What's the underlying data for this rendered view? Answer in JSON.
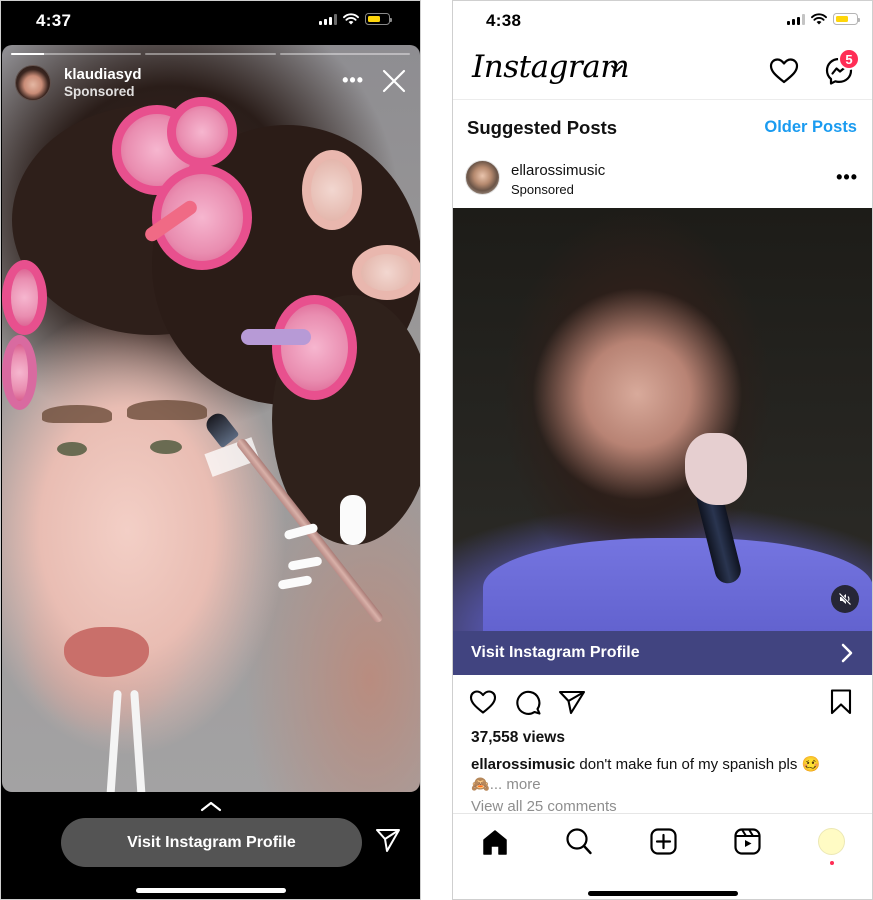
{
  "story_screen": {
    "status_bar": {
      "time": "4:37",
      "signal_bars": 3,
      "battery_level": 0.5
    },
    "progress": {
      "segments": 3,
      "active_index": 0,
      "active_fill": 0.25
    },
    "header": {
      "username": "klaudiasyd",
      "sponsored_label": "Sponsored",
      "more_icon": "ellipsis-icon",
      "more_label": "•••",
      "close_icon": "close-icon"
    },
    "swipe_icon": "chevron-up-icon",
    "cta_label": "Visit Instagram Profile",
    "share_icon": "paper-plane-icon"
  },
  "feed_screen": {
    "status_bar": {
      "time": "4:38",
      "signal_bars": 3,
      "battery_level": 0.5
    },
    "topbar": {
      "logo_text": "Instagram",
      "logo_dropdown_icon": "chevron-down-icon",
      "activity_icon": "heart-icon",
      "messenger_icon": "messenger-icon",
      "message_badge_count": "5"
    },
    "section": {
      "title": "Suggested Posts",
      "older_posts_link": "Older Posts"
    },
    "post": {
      "username": "ellarossimusic",
      "sponsored_label": "Sponsored",
      "more_label": "•••",
      "mute_icon": "speaker-muted-icon",
      "cta_label": "Visit Instagram Profile",
      "cta_icon": "chevron-right-icon",
      "actions": [
        "heart-icon",
        "comment-icon",
        "paper-plane-icon",
        "bookmark-icon"
      ],
      "views": "37,558 views",
      "caption_user": "ellarossimusic",
      "caption_text": " don't make fun of my spanish pls 🥴",
      "caption_line2": "🙈",
      "caption_more": "... more",
      "view_comments": "View all 25 comments"
    },
    "tab_bar": {
      "items": [
        "home-icon",
        "search-icon",
        "create-post-icon",
        "reels-icon",
        "profile-avatar"
      ],
      "active": "home-icon"
    }
  },
  "colors": {
    "link_blue": "#1a9bf0",
    "badge_red": "#ff2d55",
    "cta_navy": "#414480",
    "story_cta_gray": "#545454",
    "battery_yellow": "#ffd60a"
  }
}
